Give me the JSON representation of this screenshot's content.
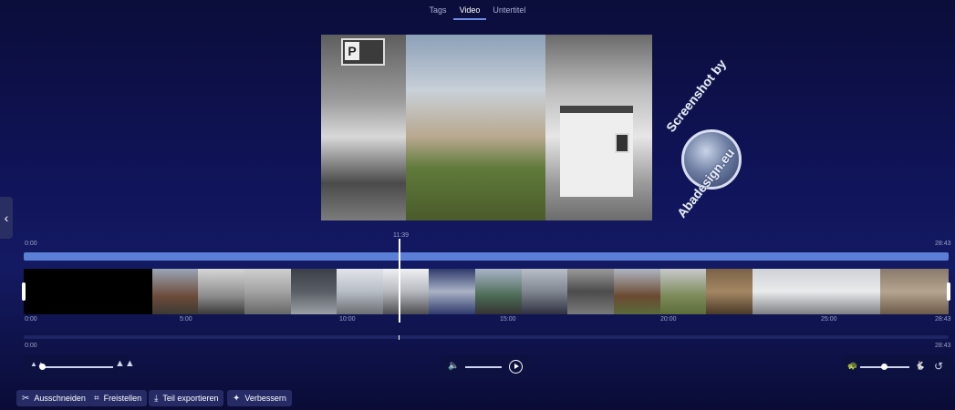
{
  "tabs": [
    {
      "label": "Tags"
    },
    {
      "label": "Video"
    },
    {
      "label": "Untertitel"
    }
  ],
  "watermark": {
    "line1": "Screenshot by",
    "line2": "Abadesign.eu"
  },
  "timeline": {
    "playhead_time": "11:39",
    "start_time": "0:00",
    "end_time": "28:43",
    "ticks": [
      "0:00",
      "5:00",
      "10:00",
      "15:00",
      "20:00",
      "25:00",
      "28:43"
    ],
    "bottom_start": "0:00",
    "bottom_end": "28:43"
  },
  "toolbar": {
    "cut_label": "Ausschneiden",
    "crop_label": "Freistellen",
    "export_label": "Teil exportieren",
    "enhance_label": "Verbessern"
  },
  "preview_sign_text": "P"
}
